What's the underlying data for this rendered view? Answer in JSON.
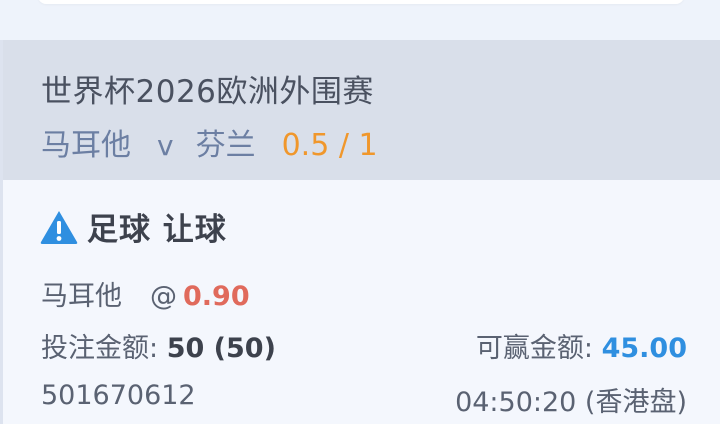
{
  "bet": {
    "league": "世界杯2026欧洲外围赛",
    "home_team": "马耳他",
    "vs": "v",
    "away_team": "芬兰",
    "handicap": "0.5 / 1",
    "bet_type": "足球 让球",
    "selection": "马耳他",
    "at_symbol": "@",
    "odds": "0.90",
    "stake_label": "投注金额:",
    "stake_value": "50 (50)",
    "win_label": "可赢金额:",
    "win_value": "45.00",
    "ticket_id": "501670612",
    "time_market": "04:50:20 (香港盘)"
  },
  "icons": {
    "bet_type_icon": "warning-icon"
  },
  "colors": {
    "handicap": "#f0972c",
    "odds": "#e06a5c",
    "win_amount": "#2f8fe0",
    "warning_icon": "#2f8fe0",
    "header_bg": "#d9dfea",
    "page_bg": "#eef3fb"
  }
}
